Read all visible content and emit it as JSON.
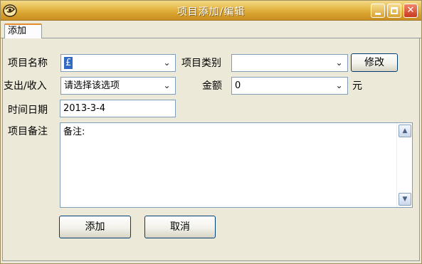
{
  "window": {
    "title": "项目添加/编辑",
    "app_icon": "swirl-app-icon",
    "controls": {
      "minimize": "minimize-icon",
      "maximize": "maximize-icon",
      "close": "close-icon",
      "close_glyph": "✕"
    }
  },
  "tabs": [
    {
      "label": "添加",
      "selected": true
    }
  ],
  "form": {
    "item_name": {
      "label": "项目名称",
      "value": "£"
    },
    "item_category": {
      "label": "项目类别",
      "value": ""
    },
    "edit_button": "修改",
    "direction": {
      "label": "支出/收入",
      "value": "请选择该选项"
    },
    "amount": {
      "label": "金额",
      "value": "0",
      "unit": "元"
    },
    "date": {
      "label": "时间日期",
      "value": "2013-3-4"
    },
    "note": {
      "label": "项目备注",
      "value": "备注:"
    }
  },
  "buttons": {
    "add": "添加",
    "cancel": "取消"
  },
  "icons": {
    "dropdown_arrow": "⌄",
    "scroll_up": "▲",
    "scroll_down": "▼"
  },
  "colors": {
    "titlebar": "#e2b13e",
    "window_bg": "#ece9d8",
    "selection": "#316ac5",
    "close_button": "#d9532f"
  }
}
